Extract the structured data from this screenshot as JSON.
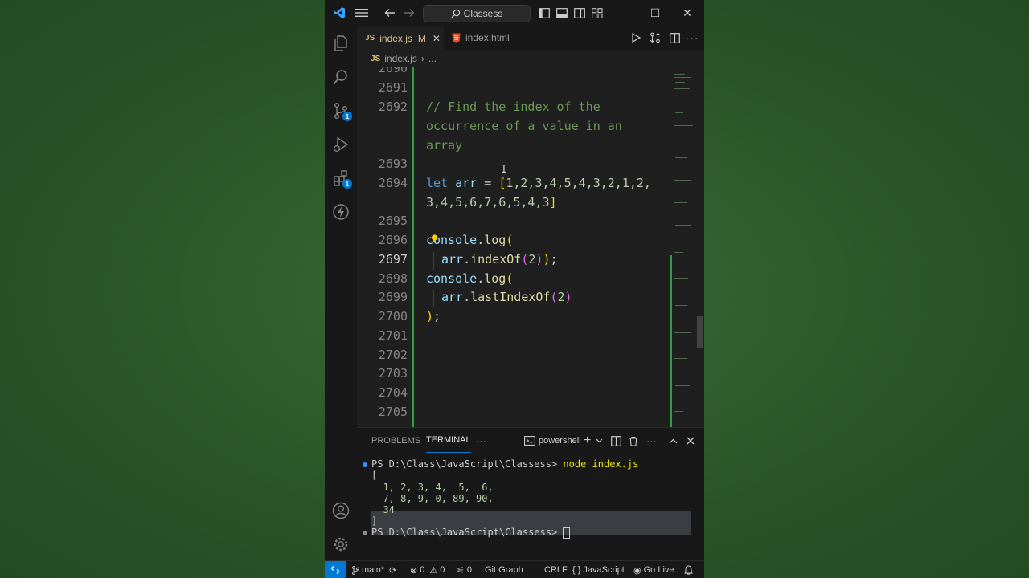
{
  "window": {
    "command_center": "Classess",
    "controls": {
      "minimize": "—",
      "maximize": "☐",
      "close": "✕"
    }
  },
  "activity_bar": {
    "source_control_badge": "1",
    "extensions_badge": "1"
  },
  "tabs": [
    {
      "icon_text": "JS",
      "label": "index.js",
      "status": "M",
      "close": "✕"
    },
    {
      "label": "index.html"
    }
  ],
  "breadcrumb": {
    "file_icon": "JS",
    "file": "index.js",
    "sep": "›",
    "more": "..."
  },
  "editor": {
    "top_partial_line_number": "2690",
    "line_numbers": [
      "2691",
      "2692",
      "2693",
      "2694",
      "2695",
      "2696",
      "2697",
      "2698",
      "2699",
      "2700",
      "2701",
      "2702",
      "2703",
      "2704",
      "2705"
    ],
    "current_line": "2697",
    "comment": [
      "// Find the index of the",
      "occurrence of a value in an",
      "array"
    ],
    "let_kw": "let",
    "arr_name": "arr",
    "arr_eq": " =",
    "arr_line1": "1,2,3,4,5,4,3,2,1,2,",
    "arr_line2": "3,4,5,6,7,6,5,4,3",
    "console": "console",
    "log": "log",
    "index_of": "indexOf",
    "last_index_of": "lastIndexOf",
    "arg": "2"
  },
  "panel": {
    "tabs": [
      "PROBLEMS",
      "TERMINAL"
    ],
    "active_tab": "TERMINAL",
    "more": "···",
    "shell": "powershell",
    "add": "+",
    "terminal": {
      "prompt1": "PS D:\\Class\\JavaScript\\Classess> ",
      "command": "node index.js",
      "open_bracket": "[",
      "row1": "  1, 2, 3, 4,  5,  6,",
      "row2": "  7, 8, 9, 0, 89, 90,",
      "row3": "  34",
      "close_bracket": "]",
      "prompt2": "PS D:\\Class\\JavaScript\\Classess> "
    }
  },
  "status_bar": {
    "branch": "main*",
    "errors": "0",
    "warnings": "0",
    "ports": "0",
    "git_graph": "Git Graph",
    "eol": "CRLF",
    "language": "JavaScript",
    "go_live": "Go Live"
  },
  "colors": {
    "accent": "#0078d4",
    "comment": "#6a9955",
    "keyword": "#569cd6",
    "function": "#dcdcaa",
    "git_modified_bar": "#2ea043",
    "desktop_bg": "#2d5a2d"
  }
}
